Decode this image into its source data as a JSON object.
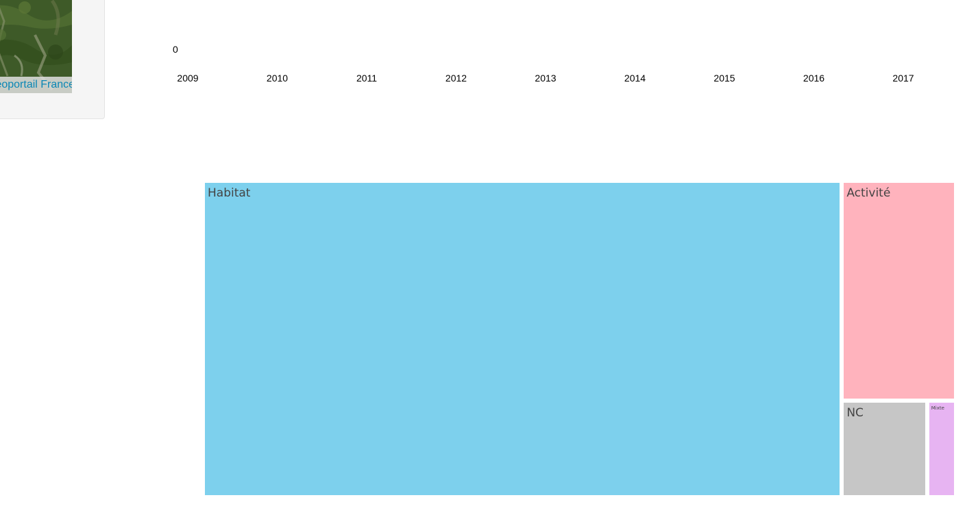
{
  "map": {
    "attribution": "Géoportail France"
  },
  "chart_data": [
    {
      "type": "line",
      "x": [
        "2009",
        "2010",
        "2011",
        "2012",
        "2013",
        "2014",
        "2015",
        "2016",
        "2017"
      ],
      "y_ticks": [
        "0"
      ],
      "series": []
    },
    {
      "type": "treemap",
      "categories": [
        "Habitat",
        "Activité",
        "NC",
        "Mixte"
      ],
      "values": [
        84.6,
        10.4,
        3.4,
        1.1
      ],
      "colors": [
        "#7dd0ed",
        "#ffb3bd",
        "#c6c6c6",
        "#e7b4f2"
      ]
    }
  ]
}
